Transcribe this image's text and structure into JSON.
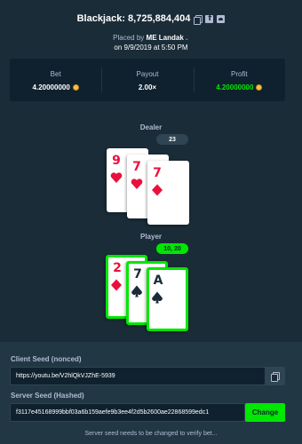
{
  "header": {
    "title": "Blackjack: 8,725,884,404",
    "placed_by_prefix": "Placed by",
    "user": "ME Landak",
    "date": "on 9/9/2019 at 5:50 PM"
  },
  "stats": {
    "bet_label": "Bet",
    "bet_value": "4.20000000",
    "payout_label": "Payout",
    "payout_value": "2.00×",
    "profit_label": "Profit",
    "profit_value": "4.20000000"
  },
  "dealer": {
    "label": "Dealer",
    "score": "23",
    "cards": [
      {
        "rank": "9",
        "suit": "heart"
      },
      {
        "rank": "7",
        "suit": "heart"
      },
      {
        "rank": "7",
        "suit": "diamond"
      }
    ]
  },
  "player": {
    "label": "Player",
    "score": "10, 20",
    "cards": [
      {
        "rank": "2",
        "suit": "diamond"
      },
      {
        "rank": "7",
        "suit": "spade"
      },
      {
        "rank": "A",
        "suit": "spade"
      }
    ]
  },
  "seeds": {
    "client_label": "Client Seed (nonced)",
    "client_value": "https://youtu.be/V2hlQkVJZhE-5939",
    "server_label": "Server Seed (Hashed)",
    "server_value": "f3117e45168999bbf03a6b159aefe9b3ee4f2d5b2600ae22868599edc1",
    "change_label": "Change",
    "note": "Server seed needs to be changed to verify bet..."
  },
  "colors": {
    "background": "#1a2c38",
    "panel": "#0f212e",
    "accent_green": "#00e701",
    "card_red": "#e9113c"
  },
  "icons": [
    "copy-icon",
    "facebook-icon",
    "twitter-icon",
    "chevron-down-icon",
    "coin-icon",
    "heart-icon",
    "diamond-icon",
    "spade-icon"
  ]
}
